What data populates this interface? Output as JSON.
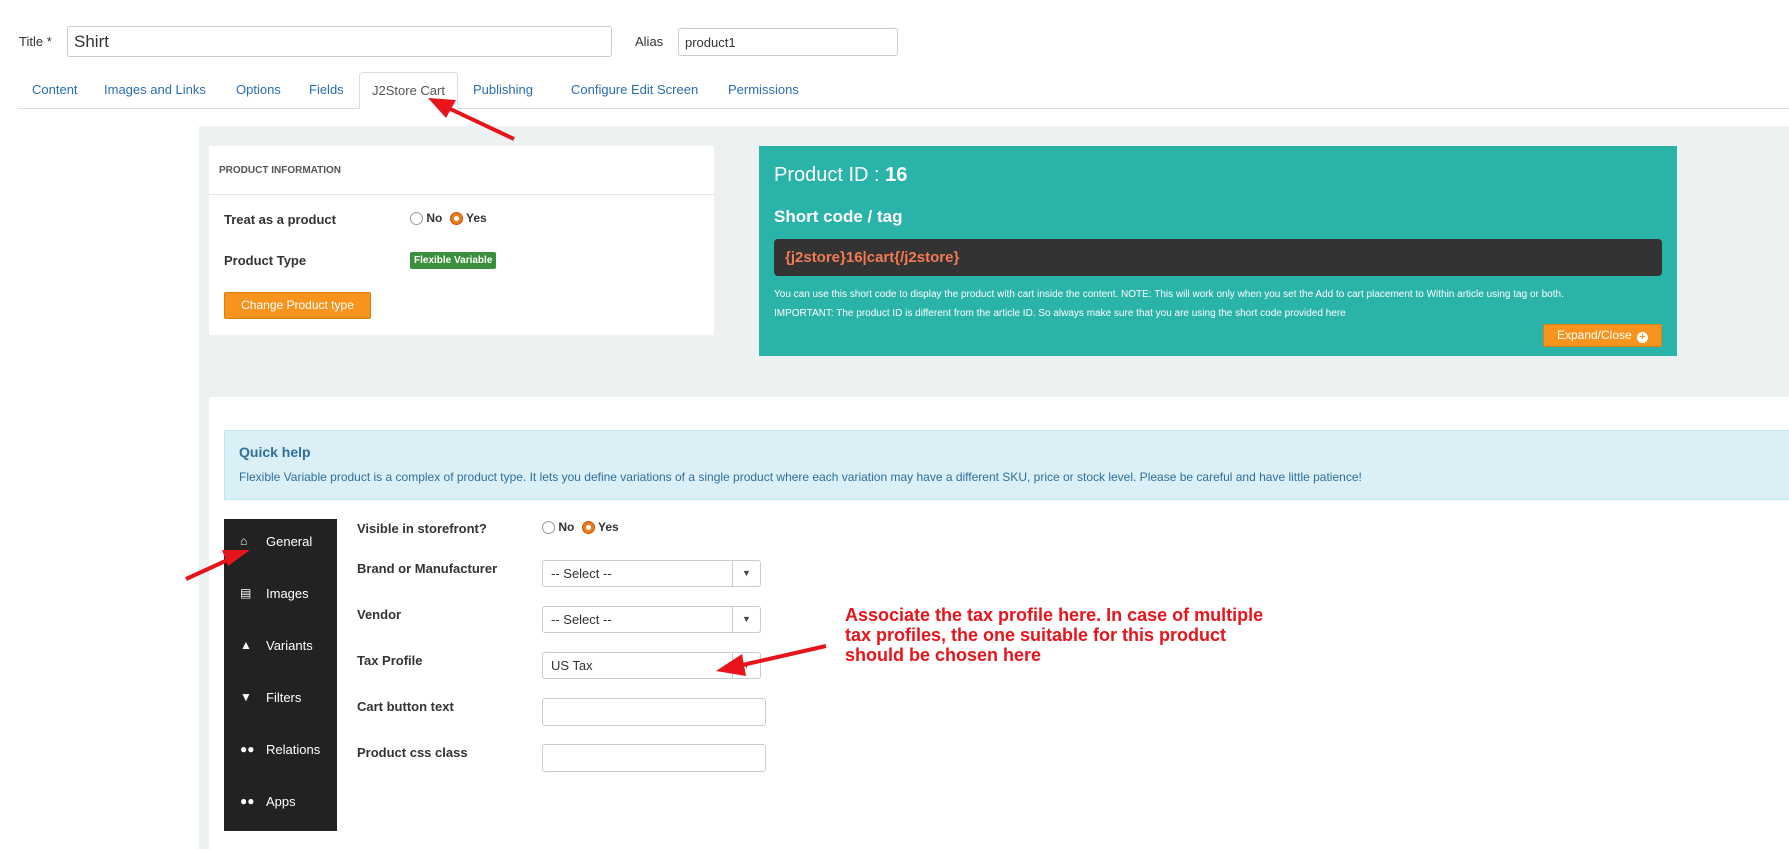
{
  "header": {
    "title_label": "Title *",
    "title_value": "Shirt",
    "alias_label": "Alias",
    "alias_value": "product1"
  },
  "tabs": [
    {
      "label": "Content"
    },
    {
      "label": "Images and Links"
    },
    {
      "label": "Options"
    },
    {
      "label": "Fields"
    },
    {
      "label": "J2Store Cart",
      "active": true
    },
    {
      "label": "Publishing"
    },
    {
      "label": "Configure Edit Screen"
    },
    {
      "label": "Permissions"
    }
  ],
  "product_info": {
    "heading": "PRODUCT INFORMATION",
    "treat_label": "Treat as a product",
    "no_label": "No",
    "yes_label": "Yes",
    "treat_value": "Yes",
    "type_label": "Product Type",
    "type_badge": "Flexible Variable",
    "change_button": "Change Product type"
  },
  "shortcode_box": {
    "product_id_label": "Product ID :",
    "product_id": "16",
    "heading": "Short code / tag",
    "code": "{j2store}16|cart{/j2store}",
    "note_line1": "You can use this short code to display the product with cart inside the content. NOTE: This will work only when you set the Add to cart placement to Within article using tag or both.",
    "note_line2": "IMPORTANT: The product ID is different from the article ID. So always make sure that you are using the short code provided here",
    "expand_button": "Expand/Close",
    "expand_icon": "plus-circle-icon"
  },
  "quick_help": {
    "title": "Quick help",
    "text": "Flexible Variable product is a complex of product type. It lets you define variations of a single product where each variation may have a different SKU, price or stock level. Please be careful and have little patience!"
  },
  "side_nav": [
    {
      "label": "General",
      "icon": "home-icon"
    },
    {
      "label": "Images",
      "icon": "image-icon"
    },
    {
      "label": "Variants",
      "icon": "sitemap-icon"
    },
    {
      "label": "Filters",
      "icon": "filter-icon"
    },
    {
      "label": "Relations",
      "icon": "users-icon"
    },
    {
      "label": "Apps",
      "icon": "users-icon"
    }
  ],
  "general_form": {
    "visible_label": "Visible in storefront?",
    "no_label": "No",
    "yes_label": "Yes",
    "visible_value": "Yes",
    "brand_label": "Brand or Manufacturer",
    "brand_value": "-- Select --",
    "vendor_label": "Vendor",
    "vendor_value": "-- Select --",
    "tax_label": "Tax Profile",
    "tax_value": "US Tax",
    "cart_button_label": "Cart button text",
    "cart_button_value": "",
    "css_class_label": "Product css class",
    "css_class_value": ""
  },
  "annotation": {
    "line1": "Associate the tax profile here. In case of multiple",
    "line2": "tax profiles, the one suitable for this product",
    "line3": "should be chosen here"
  },
  "colors": {
    "teal": "#2ab3a8",
    "orange": "#f7941d",
    "dark": "#222222",
    "link": "#2a6db0",
    "annotation_red": "#e8141c",
    "badge_green": "#3a8e3c",
    "quickhelp_bg": "#dbeff6"
  }
}
